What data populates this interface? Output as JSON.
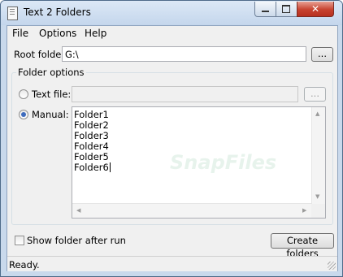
{
  "window": {
    "title": "Text 2 Folders"
  },
  "menu": {
    "items": [
      "File",
      "Options",
      "Help"
    ]
  },
  "root_folder": {
    "label": "Root folder:",
    "value": "G:\\",
    "browse_label": "..."
  },
  "folder_options": {
    "group_label": "Folder options",
    "text_file": {
      "label": "Text file:",
      "value": "",
      "browse_label": "...",
      "selected": false
    },
    "manual": {
      "label": "Manual:",
      "selected": true
    },
    "manual_lines": [
      "Folder1",
      "Folder2",
      "Folder3",
      "Folder4",
      "Folder5",
      "Folder6"
    ]
  },
  "watermark": "SnapFiles",
  "bottom": {
    "checkbox_label": "Show folder after run",
    "checked": false,
    "create_button": "Create folders"
  },
  "status": {
    "text": "Ready."
  },
  "colors": {
    "frame": "#c9d9ec",
    "radio_accent": "#3e6bbd",
    "close_red": "#c7422f"
  },
  "icons": [
    "app-icon",
    "minimize-icon",
    "maximize-icon",
    "close-icon",
    "scroll-up-icon",
    "scroll-down-icon",
    "scroll-left-icon",
    "scroll-right-icon",
    "size-grip-icon"
  ]
}
